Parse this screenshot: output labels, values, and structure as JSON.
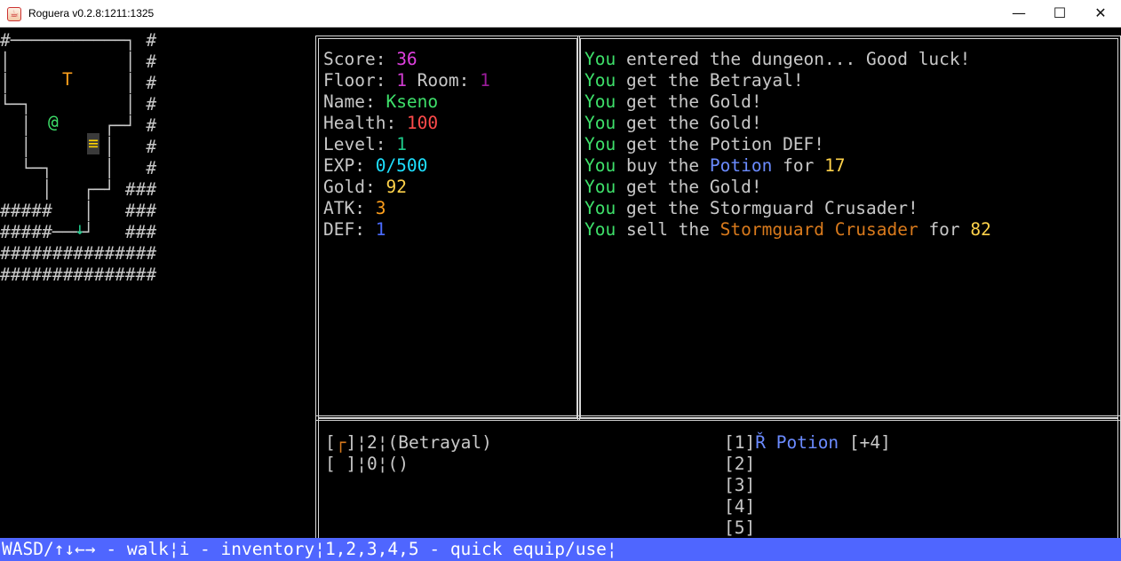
{
  "window": {
    "title": "Roguera v0.2.8:1211:1325",
    "controls": {
      "minimize": "—",
      "maximize": "☐",
      "close": "✕"
    },
    "icon": "java-cup-icon"
  },
  "map": {
    "lines": [
      "#───────────┐ #",
      "│           │ #",
      "│           │ #",
      "└─┐         │ #",
      "  │       ┌─┘ #",
      "  │       │   #",
      "  └─┐     │   #",
      "    │   ┌─┘ ###",
      "#####   │   ###",
      "#####───┘   ###",
      "###############",
      "###############"
    ],
    "entities": {
      "trap": "T",
      "player": "@",
      "stairs": "≡",
      "exit": "↓"
    }
  },
  "stats": {
    "score_label": "Score: ",
    "score": "36",
    "floor_label": "Floor: ",
    "floor": "1",
    "room_label": " Room: ",
    "room": "1",
    "name_label": "Name: ",
    "name": "Kseno",
    "health_label": "Health: ",
    "health": "100",
    "level_label": "Level: ",
    "level": "1",
    "exp_label": "EXP: ",
    "exp": "0/500",
    "gold_label": "Gold: ",
    "gold": "92",
    "atk_label": "ATK: ",
    "atk": "3",
    "def_label": "DEF: ",
    "def": "1"
  },
  "log": [
    {
      "you": "You",
      "text": " entered the dungeon... Good luck!"
    },
    {
      "you": "You",
      "text": " get the Betrayal!"
    },
    {
      "you": "You",
      "text": " get the Gold!"
    },
    {
      "you": "You",
      "text": " get the Gold!"
    },
    {
      "you": "You",
      "text": " get the Potion DEF!"
    },
    {
      "you": "You",
      "text": " buy the ",
      "item": "Potion",
      "mid": " for ",
      "price": "17"
    },
    {
      "you": "You",
      "text": " get the Gold!"
    },
    {
      "you": "You",
      "text": " get the Stormguard Crusader!"
    },
    {
      "you": "You",
      "text": " sell the ",
      "item": "Stormguard Crusader",
      "mid": " for ",
      "price": "82"
    }
  ],
  "inventory_equipped": [
    {
      "open": "[",
      "glyph": "┌",
      "close": "]",
      "rest": "¦2¦(Betrayal)"
    },
    {
      "open": "[",
      "glyph": " ",
      "close": "]",
      "rest": "¦0¦()"
    }
  ],
  "quick_slots": [
    {
      "slot": "[1]",
      "glyph": "Ř",
      "name": "Potion",
      "bonus": " [+4]"
    },
    {
      "slot": "[2]"
    },
    {
      "slot": "[3]"
    },
    {
      "slot": "[4]"
    },
    {
      "slot": "[5]"
    }
  ],
  "statusbar": {
    "text": "WASD/↑↓←→ - walk¦i - inventory¦1,2,3,4,5 - quick equip/use¦"
  },
  "colors": {
    "statusbar_bg": "#4f66ff",
    "you": "#3ee06a",
    "score": "#e040e0",
    "health": "#ff4b4b",
    "gold": "#ffd24a",
    "potion": "#6b8bff",
    "weapon": "#d97a1c"
  }
}
